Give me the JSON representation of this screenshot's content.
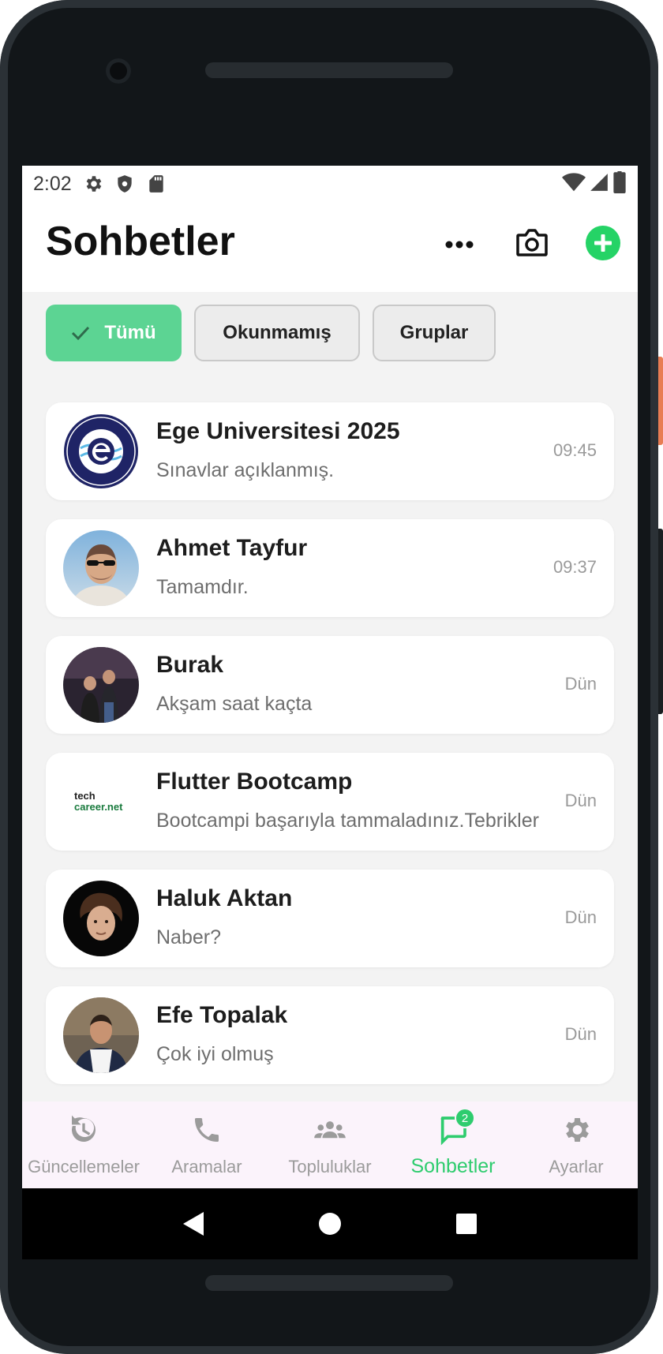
{
  "status_bar": {
    "time": "2:02"
  },
  "app_bar": {
    "title": "Sohbetler"
  },
  "filters": [
    {
      "label": "Tümü",
      "selected": true
    },
    {
      "label": "Okunmamış",
      "selected": false
    },
    {
      "label": "Gruplar",
      "selected": false
    }
  ],
  "chats": [
    {
      "name": "Ege Universitesi 2025",
      "message": "Sınavlar açıklanmış.",
      "time": "09:45",
      "avatar": "ege-logo"
    },
    {
      "name": "Ahmet Tayfur",
      "message": "Tamamdır.",
      "time": "09:37",
      "avatar": "photo"
    },
    {
      "name": "Burak",
      "message": "Akşam saat kaçta",
      "time": "Dün",
      "avatar": "photo"
    },
    {
      "name": "Flutter Bootcamp",
      "message": "Bootcampi başarıyla tammaladınız.Tebrikler",
      "time": "Dün",
      "avatar": "techcareer-logo",
      "avatar_text_1": "tech",
      "avatar_text_2": "career.net"
    },
    {
      "name": "Haluk Aktan",
      "message": "Naber?",
      "time": "Dün",
      "avatar": "photo"
    },
    {
      "name": "Efe Topalak",
      "message": "Çok iyi olmuş",
      "time": "Dün",
      "avatar": "photo"
    }
  ],
  "bottom_nav": [
    {
      "label": "Güncellemeler",
      "icon": "updates-icon",
      "active": false
    },
    {
      "label": "Aramalar",
      "icon": "phone-icon",
      "active": false
    },
    {
      "label": "Topluluklar",
      "icon": "communities-icon",
      "active": false
    },
    {
      "label": "Sohbetler",
      "icon": "chat-icon",
      "active": true,
      "badge": "2"
    },
    {
      "label": "Ayarlar",
      "icon": "gear-icon",
      "active": false
    }
  ],
  "colors": {
    "accent": "#2ecc6e",
    "chip_selected": "#5cd493",
    "nav_background": "#fbf3fb",
    "list_background": "#f3f3f3"
  }
}
